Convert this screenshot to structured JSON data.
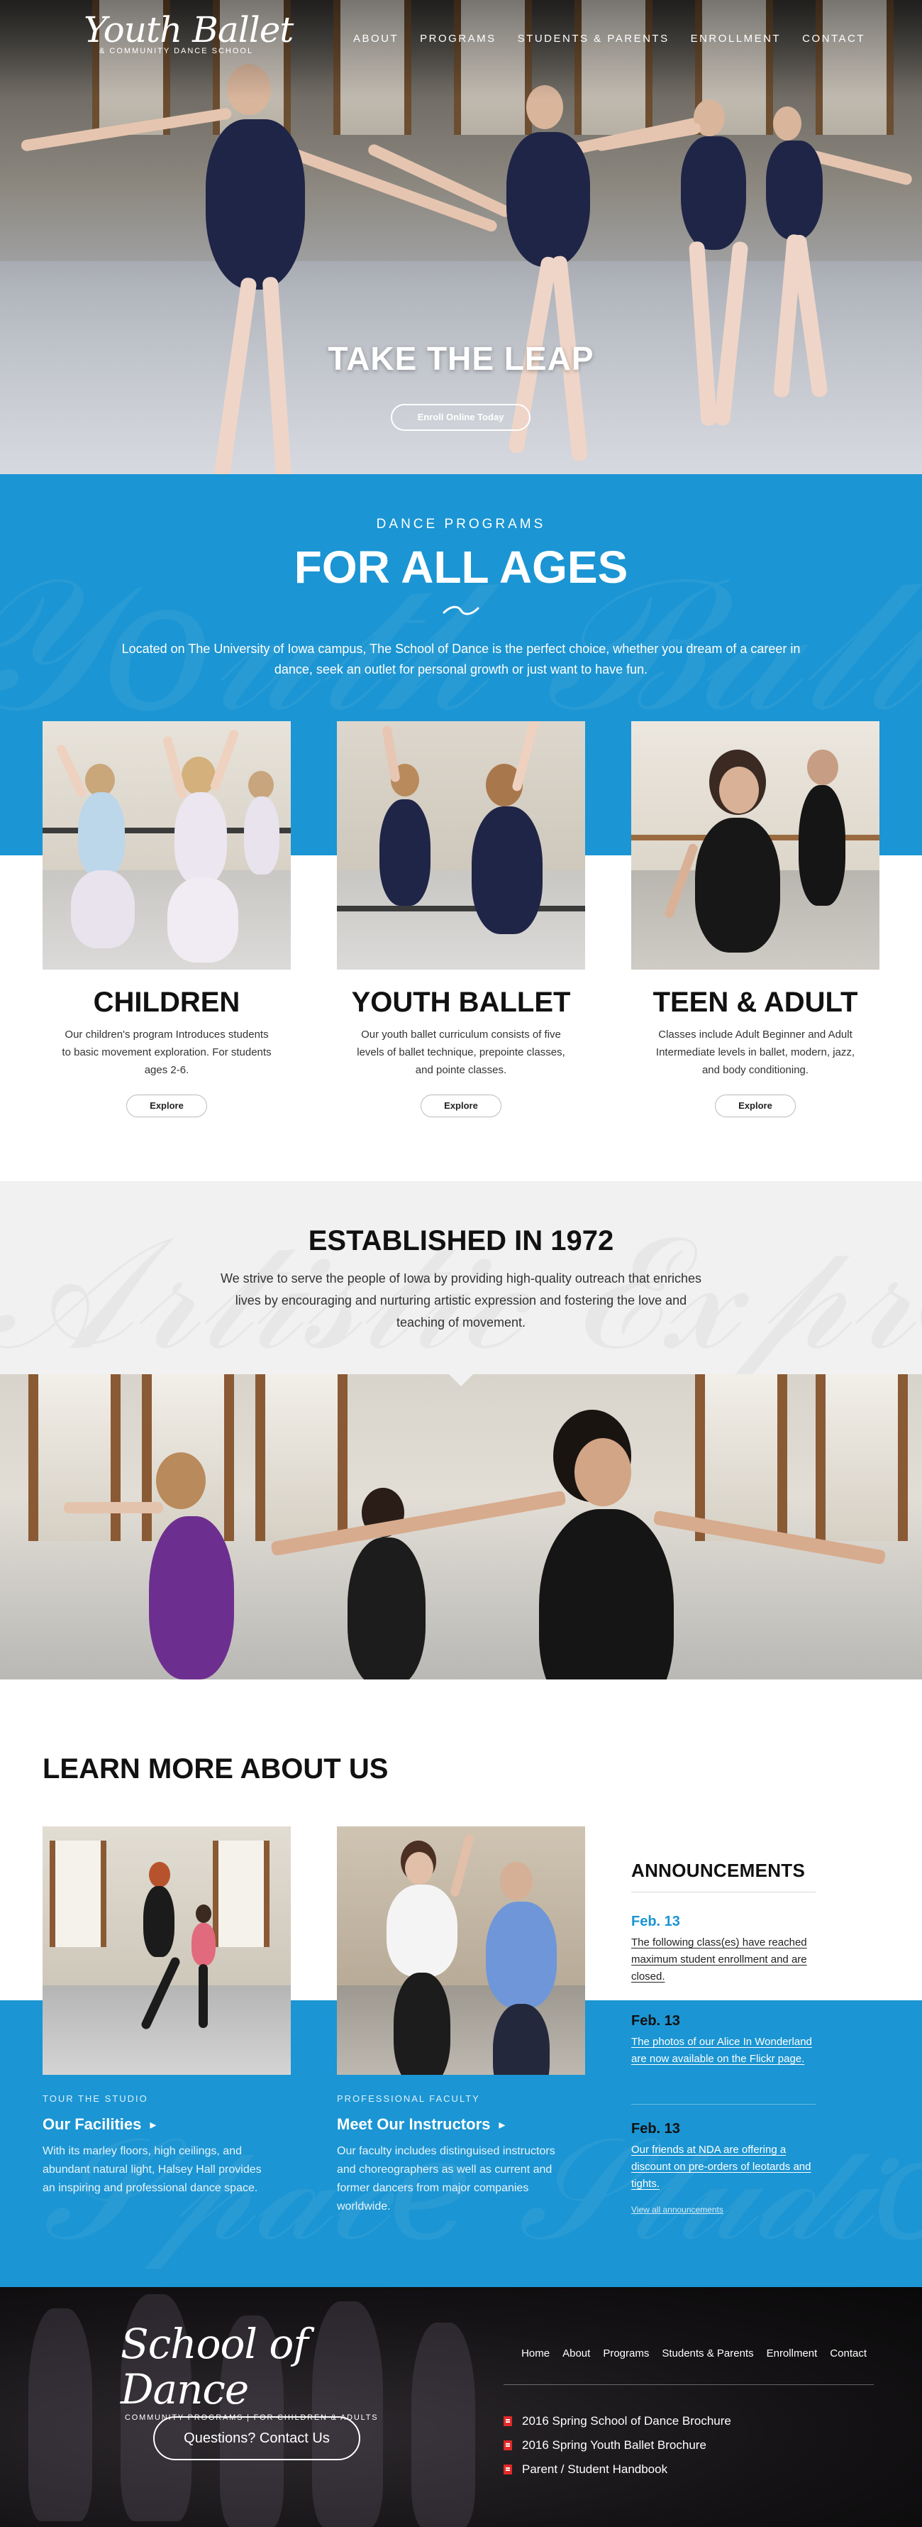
{
  "header": {
    "logo_script": "Youth Ballet",
    "logo_sub": "& COMMUNITY DANCE SCHOOL",
    "nav": [
      "ABOUT",
      "PROGRAMS",
      "STUDENTS & PARENTS",
      "ENROLLMENT",
      "CONTACT"
    ]
  },
  "hero": {
    "title": "TAKE THE LEAP",
    "button": "Enroll Online Today"
  },
  "programs": {
    "kicker": "DANCE PROGRAMS",
    "title": "FOR ALL AGES",
    "intro": "Located on The University of Iowa campus, The School of Dance is the perfect choice, whether you dream of a career in dance, seek an outlet for personal growth or just want to have fun.",
    "cards": [
      {
        "title": "CHILDREN",
        "text": "Our children's program Introduces students to basic movement exploration. For students ages 2-6.",
        "button": "Explore"
      },
      {
        "title": "YOUTH BALLET",
        "text": "Our youth ballet curriculum consists of five levels of ballet technique, prepointe classes, and pointe classes.",
        "button": "Explore"
      },
      {
        "title": "TEEN & ADULT",
        "text": "Classes include Adult Beginner and Adult Intermediate levels in ballet, modern, jazz, and body conditioning.",
        "button": "Explore"
      }
    ]
  },
  "established": {
    "title": "ESTABLISHED IN 1972",
    "text": "We strive to serve the people of Iowa by providing high-quality outreach that enriches lives by encouraging and nurturing artistic expression and fostering the love and teaching of movement."
  },
  "learn": {
    "title": "LEARN MORE ABOUT US",
    "features": [
      {
        "kicker": "TOUR THE STUDIO",
        "title": "Our Facilities",
        "text": "With its marley floors, high ceilings, and abundant natural light, Halsey Hall provides an inspiring and professional dance space."
      },
      {
        "kicker": "PROFESSIONAL FACULTY",
        "title": "Meet Our Instructors",
        "text": "Our faculty includes distinguised instructors and choreographers as well as current and former dancers from major companies worldwide."
      }
    ],
    "announcements": {
      "title": "ANNOUNCEMENTS",
      "items": [
        {
          "date": "Feb. 13",
          "text": "The following class(es) have reached maximum student enrollment and are closed."
        },
        {
          "date": "Feb. 13",
          "text": "The photos of our Alice In Wonderland are now available  on the Flickr page."
        },
        {
          "date": "Feb. 13",
          "text": "Our friends at NDA are offering a discount on pre-orders of leotards and tights."
        }
      ],
      "view_all": "View all announcements"
    }
  },
  "footer": {
    "logo_script": "School of Dance",
    "logo_sub": "COMMUNITY PROGRAMS  |  FOR CHILDREN & ADULTS",
    "contact_button": "Questions? Contact Us",
    "nav": [
      "Home",
      "About",
      "Programs",
      "Students & Parents",
      "Enrollment",
      "Contact"
    ],
    "documents": [
      "2016 Spring School of Dance Brochure",
      "2016 Spring Youth Ballet Brochure",
      "Parent / Student Handbook"
    ]
  },
  "colors": {
    "brand_blue": "#1b95d3",
    "pdf_red": "#e02a2a",
    "dark_footer": "#141214"
  }
}
